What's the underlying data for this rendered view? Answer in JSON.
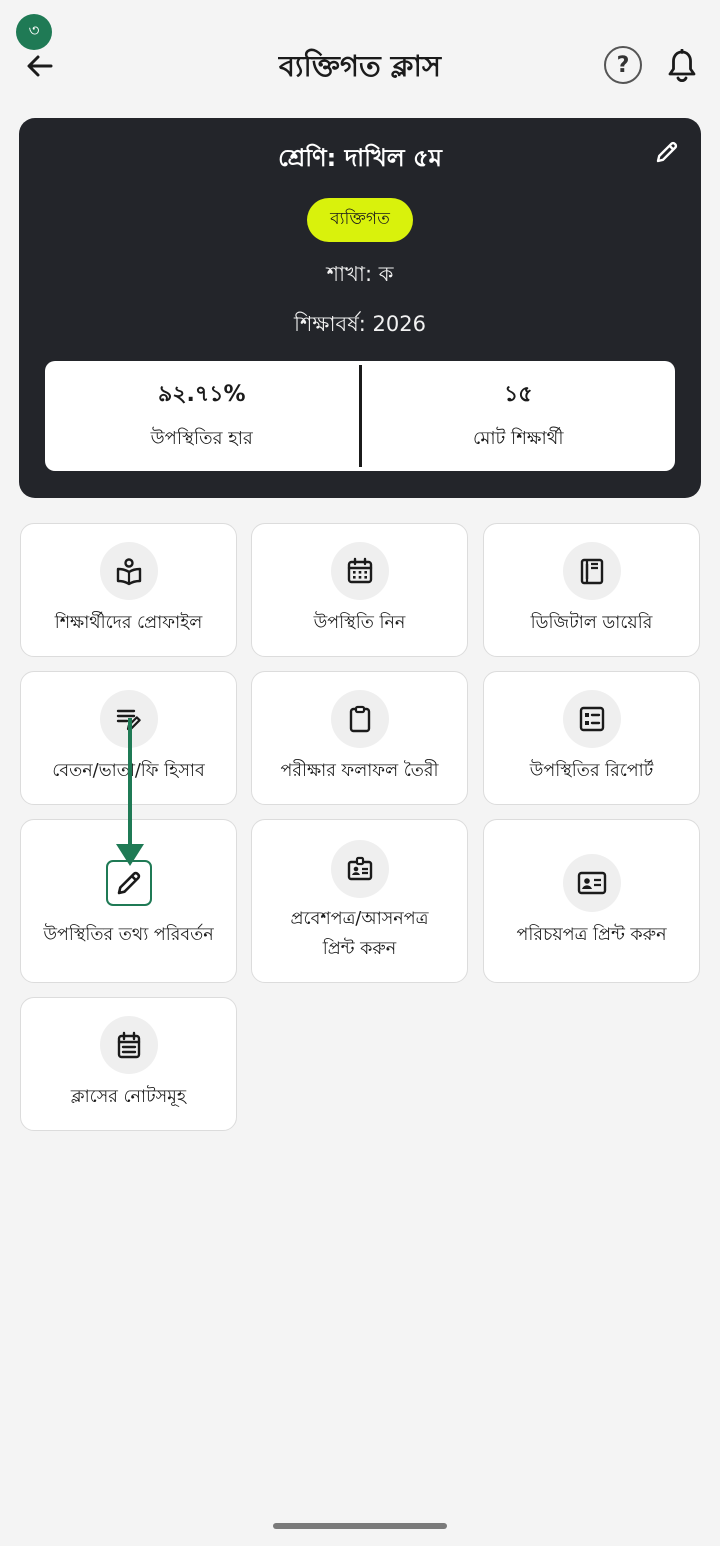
{
  "header": {
    "step_badge": "৩",
    "title": "ব্যক্তিগত ক্লাস",
    "help_label": "?"
  },
  "class_card": {
    "title": "শ্রেণি: দাখিল ৫ম",
    "type_badge": "ব্যক্তিগত",
    "section": "শাখা: ক",
    "academic_year": "শিক্ষাবর্ষ: 2026",
    "stats": {
      "attendance_rate": {
        "value": "৯২.৭১%",
        "label": "উপস্থিতির হার"
      },
      "total_students": {
        "value": "১৫",
        "label": "মোট শিক্ষার্থী"
      }
    }
  },
  "menu": {
    "student_profile": "শিক্ষার্থীদের প্রোফাইল",
    "take_attendance": "উপস্থিতি নিন",
    "digital_diary": "ডিজিটাল ডায়েরি",
    "salary_fee": "বেতন/ভাতা/ফি হিসাব",
    "exam_result": "পরীক্ষার ফলাফল তৈরী",
    "attendance_report": "উপস্থিতির রিপোর্ট",
    "edit_attendance": "উপস্থিতির তথ্য পরিবর্তন",
    "admit_card_line1": "প্রবেশপত্র/আসনপত্র",
    "admit_card_line2": "প্রিন্ট করুন",
    "id_card": "পরিচয়পত্র প্রিন্ট করুন",
    "class_notes": "ক্লাসের নোটসমূহ"
  },
  "colors": {
    "accent_green": "#1f7a55",
    "badge_lime": "#d9f20c",
    "card_dark": "#23252a"
  },
  "icons": {
    "back": "arrow-left-icon",
    "help": "question-circle-icon",
    "notifications": "bell-icon",
    "edit": "pencil-icon"
  }
}
